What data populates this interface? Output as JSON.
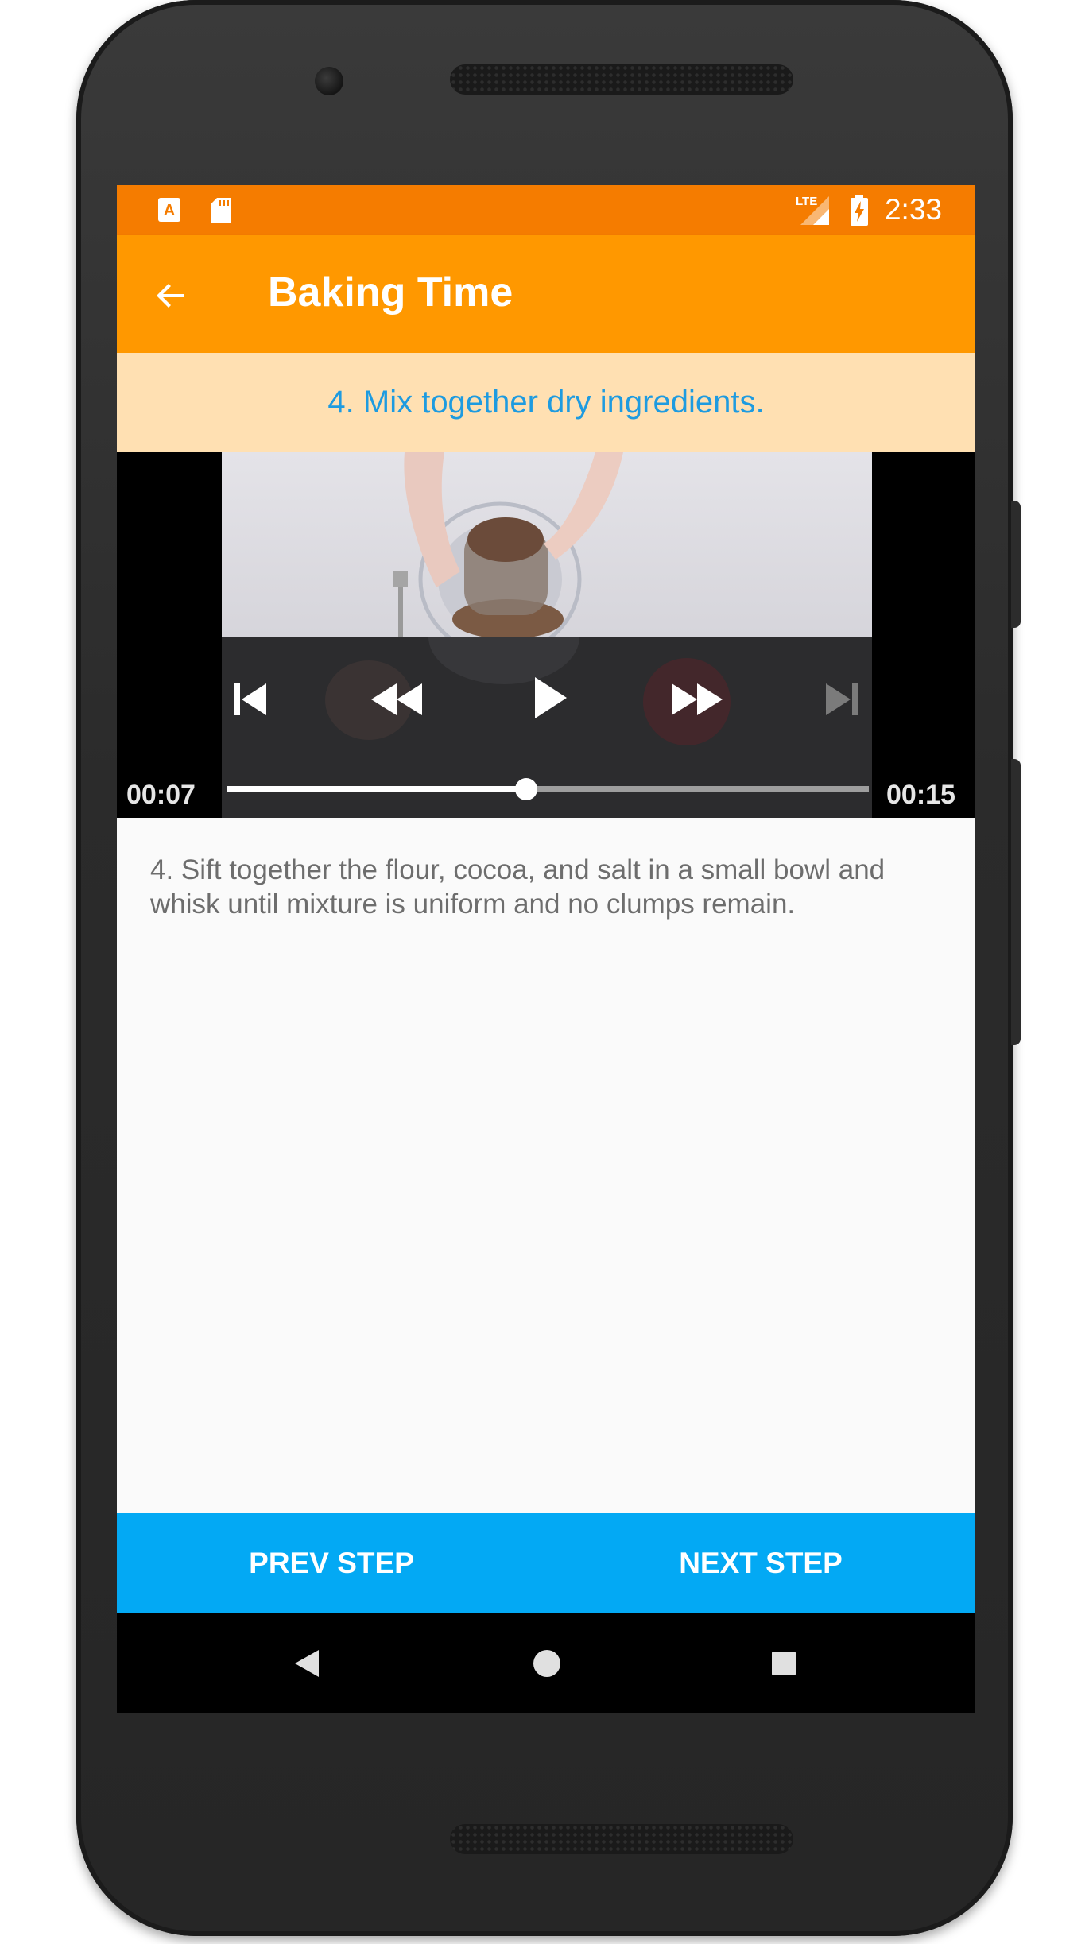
{
  "status_bar": {
    "time": "2:33",
    "network": "LTE",
    "icons": [
      "notification-a-icon",
      "sd-card-icon",
      "lte-signal-icon",
      "battery-charging-icon"
    ]
  },
  "app_bar": {
    "title": "Baking Time",
    "back_icon": "arrow-back-icon"
  },
  "step": {
    "title": "4. Mix together dry ingredients.",
    "description": "4. Sift together the flour, cocoa, and salt in a small bowl and whisk until mixture is uniform and no clumps remain."
  },
  "player": {
    "position": "00:07",
    "duration": "00:15",
    "progress_fraction": 0.466,
    "controls": [
      "skip-previous-icon",
      "rewind-icon",
      "play-icon",
      "fast-forward-icon",
      "skip-next-icon"
    ]
  },
  "navigation": {
    "prev_label": "PREV STEP",
    "next_label": "NEXT STEP"
  },
  "system_nav": [
    "back-triangle-icon",
    "home-circle-icon",
    "recents-square-icon"
  ],
  "colors": {
    "status_bar": "#f57c00",
    "app_bar": "#ff9800",
    "step_title_bg": "#ffe0b2",
    "step_title_text": "#1e9be0",
    "nav_buttons": "#03a9f4"
  }
}
